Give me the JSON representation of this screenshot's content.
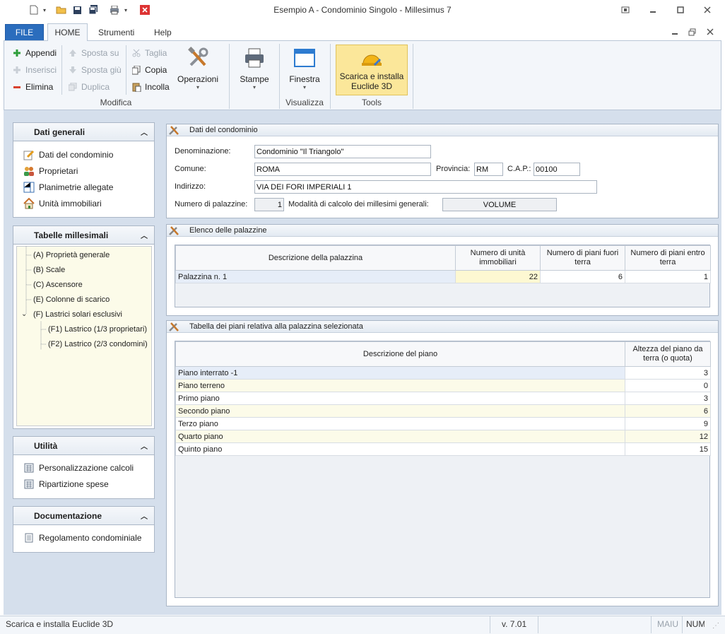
{
  "window": {
    "title": "Esempio A - Condominio Singolo - Millesimus 7",
    "quick_access": [
      "new-file-icon",
      "open-folder-icon",
      "save-icon",
      "save-all-icon",
      "print-icon",
      "close-document-icon"
    ]
  },
  "tabs": [
    {
      "label": "FILE"
    },
    {
      "label": "HOME"
    },
    {
      "label": "Strumenti"
    },
    {
      "label": "Help"
    }
  ],
  "ribbon": {
    "modifica": {
      "appendi": "Appendi",
      "inserisci": "Inserisci",
      "elimina": "Elimina",
      "sposta_su": "Sposta su",
      "sposta_giu": "Sposta giù",
      "duplica": "Duplica",
      "taglia": "Taglia",
      "copia": "Copia",
      "incolla": "Incolla",
      "operazioni": "Operazioni",
      "group_label": "Modifica"
    },
    "stampe": {
      "label": "Stampe"
    },
    "visualizza": {
      "finestra": "Finestra",
      "group_label": "Visualizza"
    },
    "tools": {
      "line1": "Scarica e installa",
      "line2": "Euclide 3D",
      "group_label": "Tools"
    }
  },
  "sidebar": {
    "dati_generali": {
      "title": "Dati generali",
      "items": [
        {
          "label": "Dati del condominio"
        },
        {
          "label": "Proprietari"
        },
        {
          "label": "Planimetrie allegate"
        },
        {
          "label": "Unità immobiliari"
        }
      ]
    },
    "tabelle": {
      "title": "Tabelle millesimali",
      "items": [
        {
          "label": "(A) Proprietà generale"
        },
        {
          "label": "(B) Scale"
        },
        {
          "label": "(C) Ascensore"
        },
        {
          "label": "(E) Colonne di scarico"
        },
        {
          "label": "(F) Lastrici solari esclusivi"
        },
        {
          "label": "(F1) Lastrico (1/3 proprietari)"
        },
        {
          "label": "(F2) Lastrico (2/3 condomini)"
        }
      ]
    },
    "utilita": {
      "title": "Utilità",
      "items": [
        {
          "label": "Personalizzazione calcoli"
        },
        {
          "label": "Ripartizione spese"
        }
      ]
    },
    "documentazione": {
      "title": "Documentazione",
      "items": [
        {
          "label": "Regolamento condominiale"
        }
      ]
    }
  },
  "condominio": {
    "title": "Dati del condominio",
    "denominazione_label": "Denominazione:",
    "denominazione": "Condominio \"Il Triangolo\"",
    "comune_label": "Comune:",
    "comune": "ROMA",
    "provincia_label": "Provincia:",
    "provincia": "RM",
    "cap_label": "C.A.P.:",
    "cap": "00100",
    "indirizzo_label": "Indirizzo:",
    "indirizzo": "VIA DEI FORI IMPERIALI 1",
    "numero_palazzine_label": "Numero di palazzine:",
    "numero_palazzine": "1",
    "modalita_label": "Modalità di calcolo dei millesimi generali:",
    "modalita": "VOLUME"
  },
  "palazzine": {
    "title": "Elenco delle palazzine",
    "columns": [
      "Descrizione della palazzina",
      "Numero di unità immobiliari",
      "Numero di piani fuori terra",
      "Numero di piani entro terra"
    ],
    "rows": [
      {
        "descrizione": "Palazzina n. 1",
        "unita": "22",
        "fuori_terra": "6",
        "entro_terra": "1"
      }
    ]
  },
  "piani": {
    "title": "Tabella dei piani relativa alla palazzina selezionata",
    "columns": [
      "Descrizione del piano",
      "Altezza del piano da terra (o quota)"
    ],
    "rows": [
      {
        "descrizione": "Piano interrato -1",
        "altezza": "3"
      },
      {
        "descrizione": "Piano terreno",
        "altezza": "0"
      },
      {
        "descrizione": "Primo piano",
        "altezza": "3"
      },
      {
        "descrizione": "Secondo piano",
        "altezza": "6"
      },
      {
        "descrizione": "Terzo piano",
        "altezza": "9"
      },
      {
        "descrizione": "Quarto piano",
        "altezza": "12"
      },
      {
        "descrizione": "Quinto piano",
        "altezza": "15"
      }
    ]
  },
  "statusbar": {
    "message": "Scarica e installa Euclide 3D",
    "version": "v. 7.01",
    "maiu": "MAIU",
    "num": "NUM"
  },
  "colors": {
    "file_tab": "#2b6dbd",
    "ribbon_bg": "#f3f6fa",
    "workspace_bg": "#d5dfec",
    "tools_highlight": "#fbe79a",
    "tree_bg": "#fcfbe9"
  }
}
